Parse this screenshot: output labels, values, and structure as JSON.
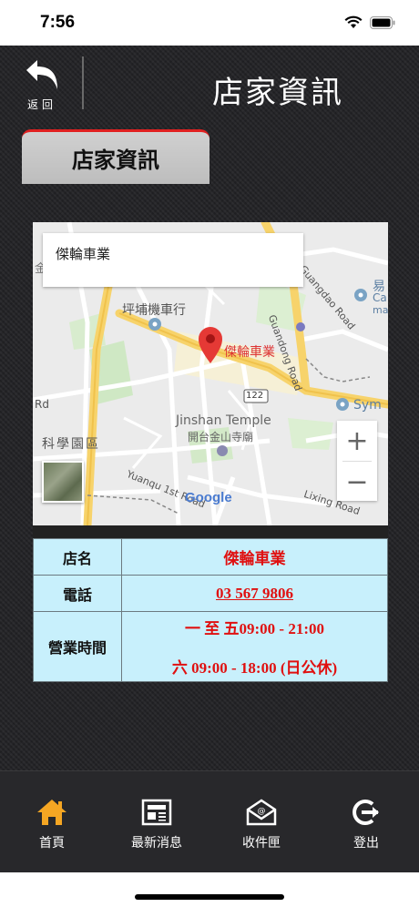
{
  "status_bar": {
    "time": "7:56"
  },
  "header": {
    "back_label": "返回",
    "title": "店家資訊"
  },
  "tab": {
    "label": "店家資訊"
  },
  "map": {
    "info_box_text": "傑輪車業",
    "marker_label": "傑輪車業",
    "zoom_in": "+",
    "zoom_out": "−",
    "labels": {
      "pingpu": "坪埔機車行",
      "jinshan_en": "Jinshan Temple",
      "jinshan_zh": "開台金山寺廟",
      "yuanqu": "Yuanqu 1st Road",
      "lixing": "Lixing Road",
      "guandong": "Guandong Road",
      "science": "科學園區",
      "route": "122",
      "sym": "Sym",
      "guangdao": "Guangdao Road",
      "rd": "Rd",
      "yi": "易",
      "ca": "Ca",
      "ma": "ma",
      "jin": "金",
      "google": "Google"
    }
  },
  "info_table": {
    "name_label": "店名",
    "name_value": "傑輪車業",
    "phone_label": "電話",
    "phone_value": "03 567 9806",
    "hours_label": "營業時間",
    "hours_weekday": "一 至 五09:00 - 21:00",
    "hours_saturday": "六 09:00 - 18:00 (日公休)"
  },
  "bottom_nav": {
    "home": "首頁",
    "news": "最新消息",
    "inbox": "收件匣",
    "logout": "登出"
  },
  "colors": {
    "accent_red": "#e01010",
    "table_bg": "#c8f0fc",
    "home_icon": "#f5a623"
  }
}
